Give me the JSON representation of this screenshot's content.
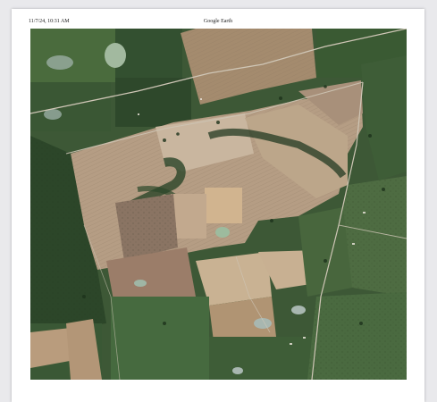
{
  "print_header": {
    "datetime": "11/7/24, 10:31 AM",
    "title": "Google Earth"
  },
  "map": {
    "kind": "satellite-imagery",
    "colors": {
      "dark_field": "#2f4a2c",
      "green_field": "#4b6a3e",
      "light_field": "#b8a189",
      "pale_field": "#c9b59d",
      "road": "#cfc6b6",
      "pond": "#9fb6a5"
    }
  }
}
